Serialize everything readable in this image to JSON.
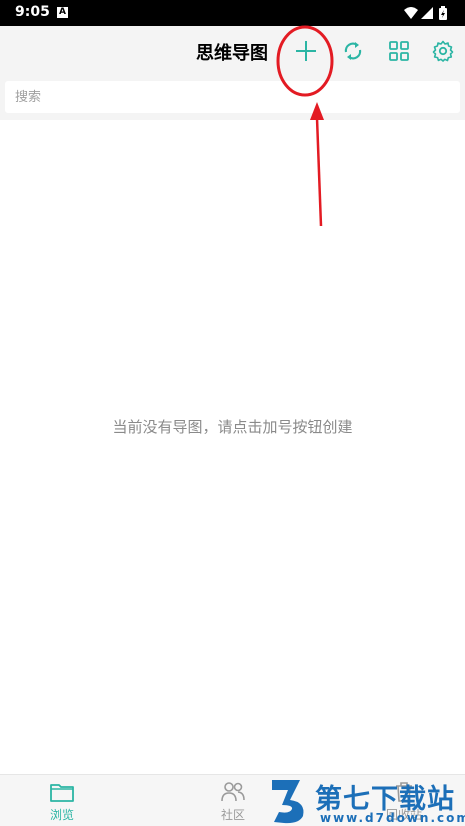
{
  "status_bar": {
    "time": "9:05",
    "notification_glyph": "A"
  },
  "header": {
    "title": "思维导图",
    "buttons": [
      "add-icon",
      "sync-icon",
      "grid-icon",
      "settings-icon"
    ]
  },
  "search": {
    "placeholder": "搜索",
    "value": ""
  },
  "main": {
    "empty_message": "当前没有导图，请点击加号按钮创建"
  },
  "bottom_nav": {
    "items": [
      {
        "label": "浏览",
        "icon": "folder-icon",
        "active": true
      },
      {
        "label": "社区",
        "icon": "users-icon",
        "active": false
      },
      {
        "label": "回收站",
        "icon": "trash-icon",
        "active": false
      }
    ]
  },
  "watermark": {
    "brand": "第七下载站",
    "url": "www.d7down.com"
  },
  "colors": {
    "accent": "#2bb5a4",
    "header_bg": "#f4f4f4",
    "annotation_red": "#e31b23",
    "watermark_blue": "#1c6fb8"
  }
}
